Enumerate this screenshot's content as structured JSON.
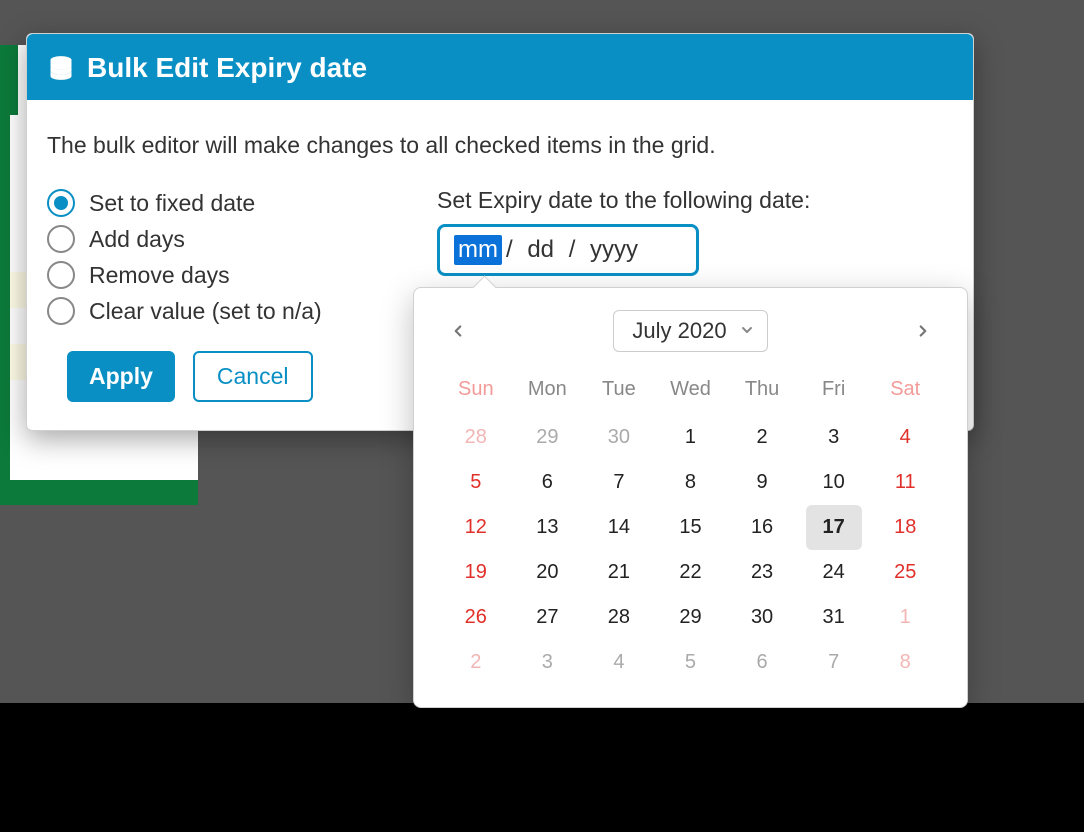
{
  "modal": {
    "title": "Bulk Edit Expiry date",
    "description": "The bulk editor will make changes to all checked items in the grid.",
    "options": [
      {
        "label": "Set to fixed date",
        "checked": true
      },
      {
        "label": "Add days",
        "checked": false
      },
      {
        "label": "Remove days",
        "checked": false
      },
      {
        "label": "Clear value (set to n/a)",
        "checked": false
      }
    ],
    "apply_label": "Apply",
    "cancel_label": "Cancel"
  },
  "date": {
    "label": "Set Expiry date to the following date:",
    "seg_mm": "mm",
    "seg_dd": "dd",
    "seg_yyyy": "yyyy",
    "sep": "/"
  },
  "calendar": {
    "month_label": "July 2020",
    "dow": [
      "Sun",
      "Mon",
      "Tue",
      "Wed",
      "Thu",
      "Fri",
      "Sat"
    ],
    "weeks": [
      [
        {
          "n": "28",
          "o": true
        },
        {
          "n": "29",
          "o": true
        },
        {
          "n": "30",
          "o": true
        },
        {
          "n": "1"
        },
        {
          "n": "2"
        },
        {
          "n": "3"
        },
        {
          "n": "4"
        }
      ],
      [
        {
          "n": "5"
        },
        {
          "n": "6"
        },
        {
          "n": "7"
        },
        {
          "n": "8"
        },
        {
          "n": "9"
        },
        {
          "n": "10"
        },
        {
          "n": "11"
        }
      ],
      [
        {
          "n": "12"
        },
        {
          "n": "13"
        },
        {
          "n": "14"
        },
        {
          "n": "15"
        },
        {
          "n": "16"
        },
        {
          "n": "17",
          "t": true
        },
        {
          "n": "18"
        }
      ],
      [
        {
          "n": "19"
        },
        {
          "n": "20"
        },
        {
          "n": "21"
        },
        {
          "n": "22"
        },
        {
          "n": "23"
        },
        {
          "n": "24"
        },
        {
          "n": "25"
        }
      ],
      [
        {
          "n": "26"
        },
        {
          "n": "27"
        },
        {
          "n": "28"
        },
        {
          "n": "29"
        },
        {
          "n": "30"
        },
        {
          "n": "31"
        },
        {
          "n": "1",
          "o": true
        }
      ],
      [
        {
          "n": "2",
          "o": true
        },
        {
          "n": "3",
          "o": true
        },
        {
          "n": "4",
          "o": true
        },
        {
          "n": "5",
          "o": true
        },
        {
          "n": "6",
          "o": true
        },
        {
          "n": "7",
          "o": true
        },
        {
          "n": "8",
          "o": true
        }
      ]
    ]
  }
}
